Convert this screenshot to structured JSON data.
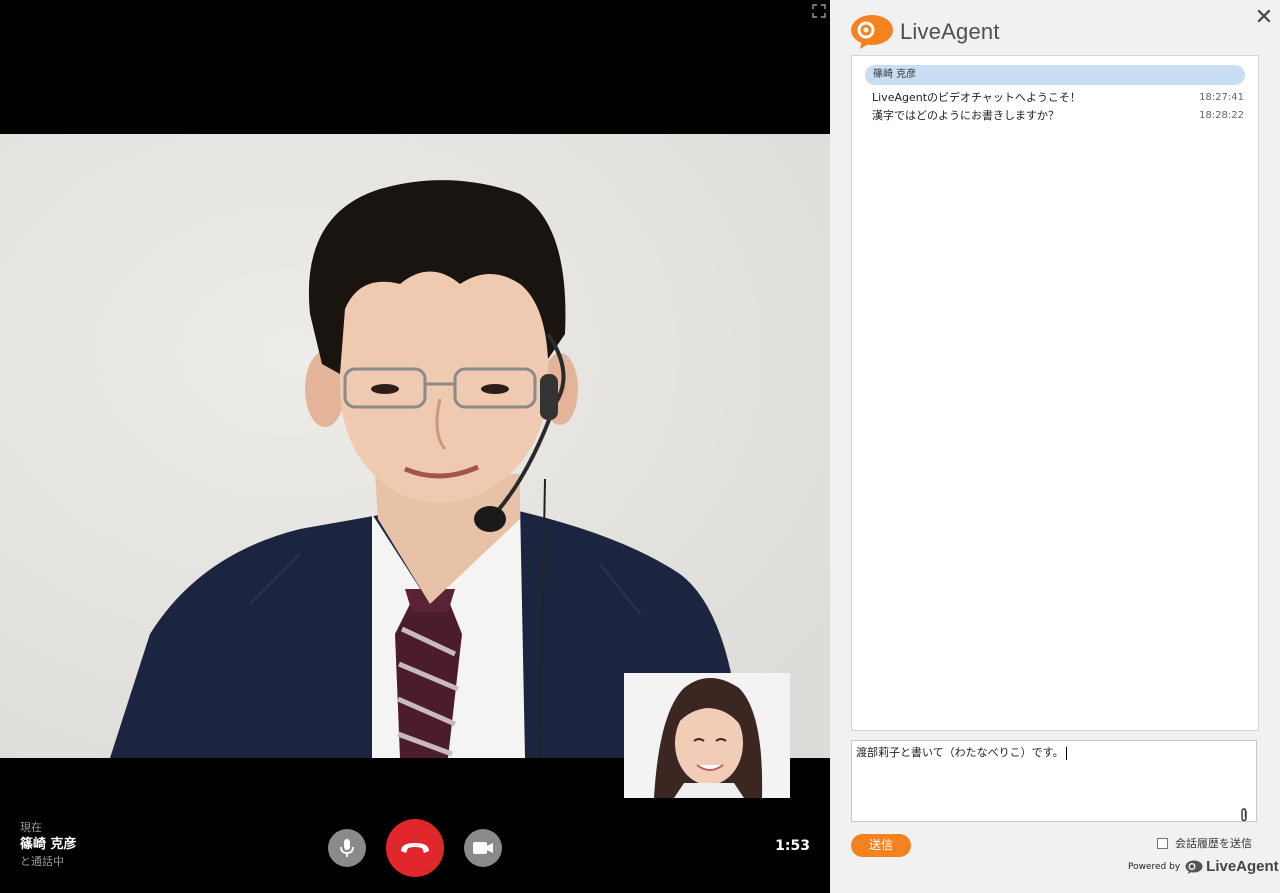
{
  "brand": {
    "name": "LiveAgent",
    "accent": "#f5821f"
  },
  "video": {
    "status_prefix": "現在",
    "caller_name": "篠崎 克彦",
    "status_suffix": "と通話中",
    "timer": "1:53"
  },
  "controls": {
    "mic_icon": "microphone-icon",
    "hangup_icon": "phone-hangup-icon",
    "camera_icon": "video-camera-icon",
    "hangup_color": "#e0282c"
  },
  "chat": {
    "participant": "篠崎 克彦",
    "messages": [
      {
        "text": "LiveAgentのビデオチャットへようこそ！",
        "time": "18:27:41"
      },
      {
        "text": "漢字ではどのようにお書きしますか？",
        "time": "18:28:22"
      }
    ],
    "input_value": "渡部莉子と書いて（わたなべりこ）です。",
    "send_label": "送信",
    "history_label": "会話履歴を送信",
    "history_checked": false,
    "powered_by": "Powered by",
    "powered_brand": "LiveAgent"
  }
}
